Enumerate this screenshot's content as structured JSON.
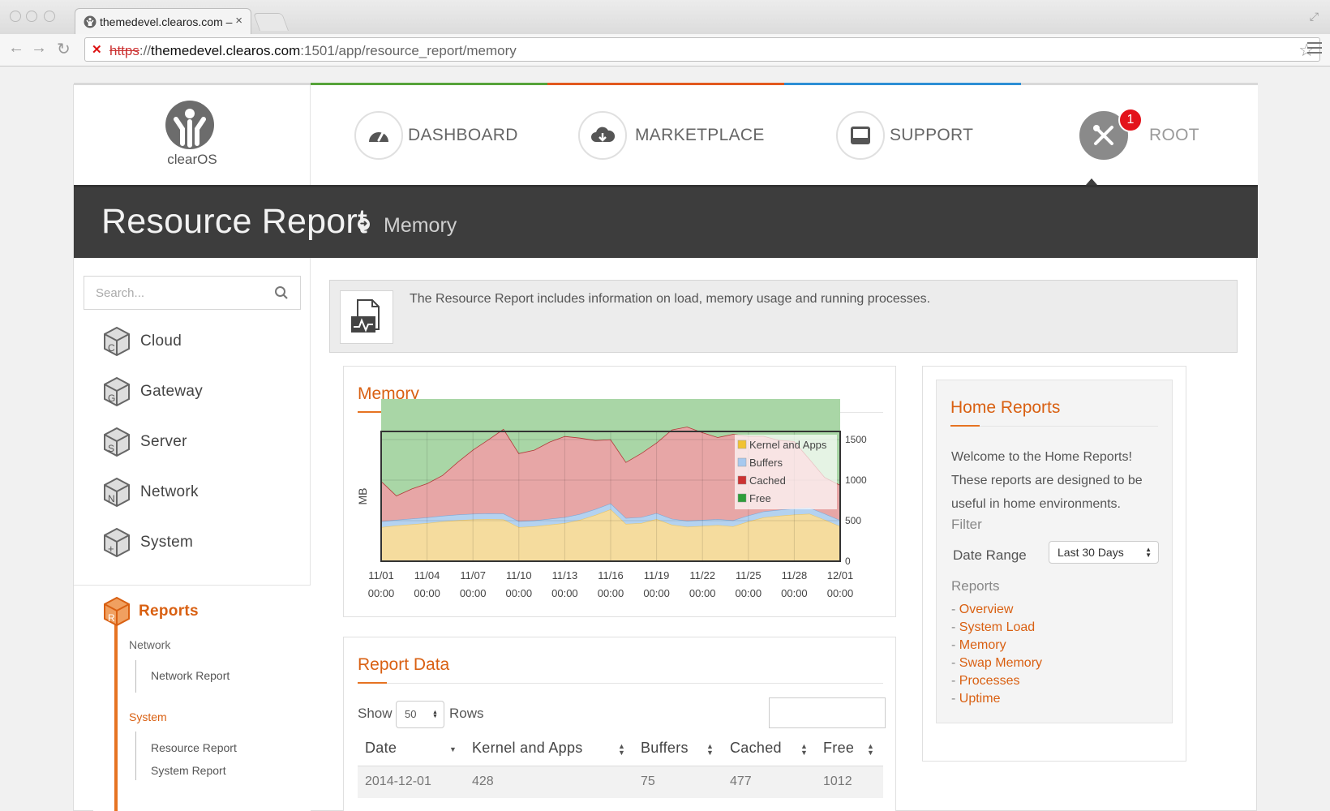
{
  "browser": {
    "tab_title": "themedevel.clearos.com –",
    "url_scheme": "https",
    "url_host": "themedevel.clearos.com",
    "url_path": ":1501/app/resource_report/memory"
  },
  "brand": {
    "logo_text": "clearOS"
  },
  "topnav": {
    "items": [
      {
        "label": "DASHBOARD",
        "icon": "gauge-icon"
      },
      {
        "label": "MARKETPLACE",
        "icon": "cloud-download-icon"
      },
      {
        "label": "SUPPORT",
        "icon": "inbox-icon"
      },
      {
        "label": "ROOT",
        "icon": "tools-icon",
        "badge": "1"
      }
    ],
    "accent_colors": [
      "#d9d9d9",
      "#56a33a",
      "#e2581e",
      "#2d8fd5",
      "#d9d9d9"
    ]
  },
  "page": {
    "title": "Resource Report",
    "breadcrumb": "Memory"
  },
  "sidebar": {
    "search_placeholder": "Search...",
    "items": [
      {
        "label": "Cloud",
        "letter": "C"
      },
      {
        "label": "Gateway",
        "letter": "G"
      },
      {
        "label": "Server",
        "letter": "S"
      },
      {
        "label": "Network",
        "letter": "N"
      },
      {
        "label": "System",
        "letter": "+"
      }
    ],
    "active": {
      "label": "Reports",
      "letter": "R"
    },
    "groups": [
      {
        "label": "Network",
        "items": [
          "Network Report"
        ]
      },
      {
        "label": "System",
        "items": [
          "Resource Report",
          "System Report"
        ]
      }
    ]
  },
  "info": {
    "text": "The Resource Report includes information on load, memory usage and running processes."
  },
  "memory_panel": {
    "title": "Memory"
  },
  "chart_data": {
    "type": "area",
    "stacked": true,
    "ylabel": "MB",
    "y_axis_side": "right",
    "ylim": [
      0,
      1600
    ],
    "y_ticks": [
      0,
      500,
      1000,
      1500
    ],
    "grid": true,
    "legend": "top-right",
    "x": [
      "11/01",
      "11/02",
      "11/03",
      "11/04",
      "11/05",
      "11/06",
      "11/07",
      "11/08",
      "11/09",
      "11/10",
      "11/11",
      "11/12",
      "11/13",
      "11/14",
      "11/15",
      "11/16",
      "11/17",
      "11/18",
      "11/19",
      "11/20",
      "11/21",
      "11/22",
      "11/23",
      "11/24",
      "11/25",
      "11/26",
      "11/27",
      "11/28",
      "11/29",
      "11/30",
      "12/01"
    ],
    "x_tick_labels": [
      [
        "11/01",
        "00:00"
      ],
      [
        "11/04",
        "00:00"
      ],
      [
        "11/07",
        "00:00"
      ],
      [
        "11/10",
        "00:00"
      ],
      [
        "11/13",
        "00:00"
      ],
      [
        "11/16",
        "00:00"
      ],
      [
        "11/19",
        "00:00"
      ],
      [
        "11/22",
        "00:00"
      ],
      [
        "11/25",
        "00:00"
      ],
      [
        "11/28",
        "00:00"
      ],
      [
        "12/01",
        "00:00"
      ]
    ],
    "series": [
      {
        "name": "Kernel and Apps",
        "color": "#f5dc9e",
        "values": [
          420,
          440,
          455,
          470,
          490,
          505,
          515,
          520,
          515,
          420,
          430,
          450,
          470,
          510,
          570,
          640,
          460,
          470,
          520,
          450,
          425,
          435,
          445,
          430,
          490,
          540,
          560,
          575,
          585,
          510,
          430
        ]
      },
      {
        "name": "Buffers",
        "color": "#b4d2f0",
        "values": [
          70,
          70,
          70,
          70,
          70,
          70,
          70,
          70,
          72,
          72,
          72,
          72,
          72,
          72,
          72,
          73,
          73,
          73,
          73,
          73,
          74,
          74,
          74,
          74,
          74,
          74,
          74,
          75,
          75,
          75,
          75
        ]
      },
      {
        "name": "Cached",
        "color": "#e7a6a6",
        "values": [
          500,
          300,
          370,
          420,
          500,
          650,
          790,
          910,
          1045,
          840,
          870,
          950,
          1000,
          940,
          850,
          790,
          690,
          790,
          870,
          1100,
          1160,
          1080,
          1010,
          1065,
          980,
          930,
          860,
          830,
          600,
          450,
          435
        ]
      },
      {
        "name": "Free",
        "color": "#a9d6a6",
        "values": [
          1010,
          1190,
          1105,
          1040,
          940,
          775,
          625,
          500,
          368,
          668,
          628,
          528,
          458,
          478,
          508,
          497,
          777,
          667,
          537,
          377,
          341,
          411,
          471,
          431,
          456,
          456,
          506,
          520,
          740,
          965,
          1060
        ]
      }
    ]
  },
  "report_data": {
    "title": "Report Data",
    "show_label": "Show",
    "rows_value": "50",
    "rows_label": "Rows",
    "columns": [
      "Date",
      "Kernel and Apps",
      "Buffers",
      "Cached",
      "Free"
    ],
    "rows": [
      [
        "2014-12-01",
        "428",
        "75",
        "477",
        "1012"
      ]
    ]
  },
  "home_reports": {
    "title": "Home Reports",
    "description": "Welcome to the Home Reports! These reports are designed to be useful in home environments.",
    "filter_label": "Filter",
    "date_range_label": "Date Range",
    "date_range_value": "Last 30 Days",
    "reports_label": "Reports",
    "links": [
      "Overview",
      "System Load",
      "Memory",
      "Swap Memory",
      "Processes",
      "Uptime"
    ]
  }
}
